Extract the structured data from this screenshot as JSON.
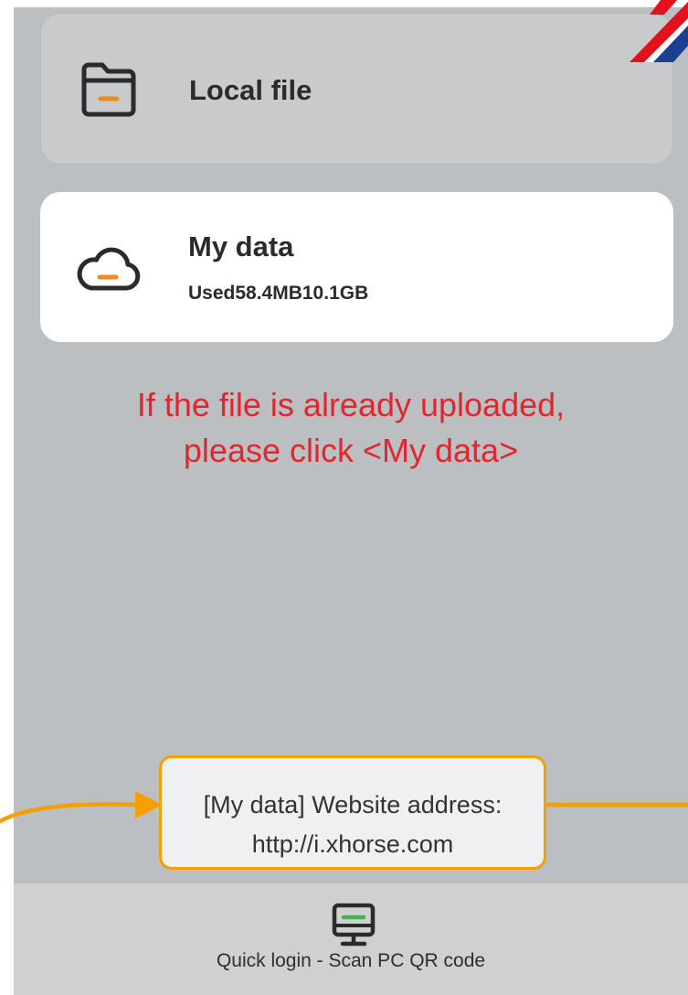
{
  "cards": {
    "local_file": {
      "title": "Local file",
      "icon": "folder-icon"
    },
    "my_data": {
      "title": "My data",
      "usage": "Used58.4MB10.1GB",
      "icon": "cloud-icon"
    }
  },
  "instruction": {
    "line1": "If the file is already uploaded,",
    "line2": "please click <My data>"
  },
  "callout": {
    "line1": "[My data] Website address:",
    "line2": "http://i.xhorse.com"
  },
  "bottom_bar": {
    "quick_login_label": "Quick login - Scan PC QR code",
    "icon": "monitor-icon"
  },
  "logo": {
    "name": "xhorse-logo",
    "letter": "X"
  },
  "colors": {
    "screen_bg": "#bcbfc2",
    "accent_orange": "#f5a000",
    "instruction_red": "#e0262e",
    "logo_red": "#e4101c",
    "logo_blue": "#1d3f8f"
  }
}
